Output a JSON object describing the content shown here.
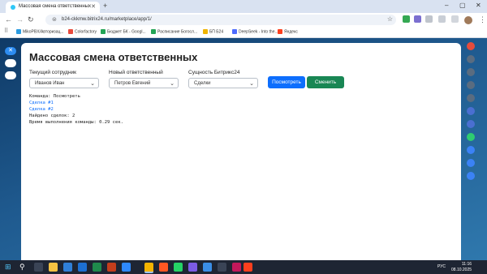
{
  "browser": {
    "tab_title": "Массовая смена ответственных",
    "url": "b24-ckkmw.bitrix24.ru/marketplace/app/1/",
    "bookmarks": [
      "MikoPBX/Авторизац...",
      "Colorfactory",
      "Бюджет БК - Googl...",
      "Расписание Богосл...",
      "БП Б24",
      "DeepSeek - Into the...",
      "Яндекс"
    ]
  },
  "app": {
    "title": "Массовая смена ответственных",
    "current_employee": {
      "label": "Текущий сотрудник",
      "value": "Иванов Иван"
    },
    "new_responsible": {
      "label": "Новый ответственный",
      "value": "Петров Евгений"
    },
    "entity": {
      "label": "Сущность Битрикс24",
      "value": "Сделки"
    },
    "view_button": "Посмотреть",
    "change_button": "Сменить",
    "log": {
      "command": "Команда: Посмотреть",
      "deal1": "Сделка #1",
      "deal2": "Сделка #2",
      "found": "Найдено сделок: 2",
      "time": "Время выполнения команды: 0.29 сек."
    }
  },
  "taskbar": {
    "lang": "РУС",
    "time": "11:16",
    "date": "08.10.2025"
  },
  "colors": {
    "primary": "#0d6efd",
    "success": "#198754",
    "sidebar": "#1f5a8f"
  }
}
